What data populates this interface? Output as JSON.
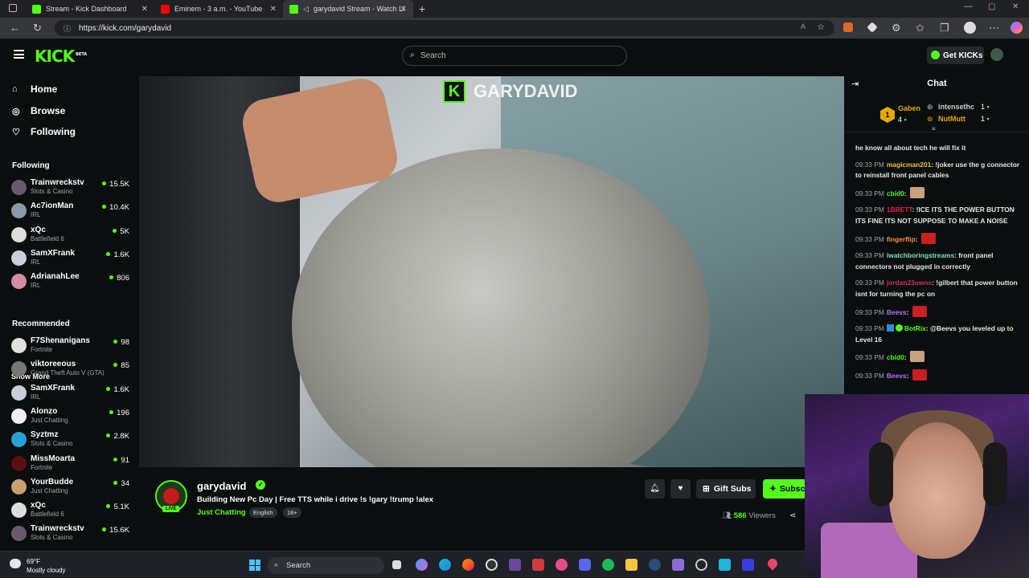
{
  "browser": {
    "tabs": [
      {
        "title": "Stream - Kick Dashboard",
        "color": "#53fc18"
      },
      {
        "title": "Eminem - 3 a.m. - YouTube",
        "color": "#ff0000"
      },
      {
        "title": "garydavid Stream - Watch Li",
        "color": "#53fc18"
      }
    ],
    "url": "https://kick.com/garydavid"
  },
  "header": {
    "logo": "KICK",
    "logo_beta": "BETA",
    "search_placeholder": "Search",
    "get_kicks": "Get KICKs"
  },
  "sidebar": {
    "nav": [
      {
        "label": "Home",
        "icon": "home-icon"
      },
      {
        "label": "Browse",
        "icon": "compass-icon"
      },
      {
        "label": "Following",
        "icon": "heart-icon"
      }
    ],
    "following_title": "Following",
    "following": [
      {
        "name": "Trainwreckstv",
        "category": "Slots & Casino",
        "viewers": "15.5K",
        "color": "#6b5a6e"
      },
      {
        "name": "Ac7ionMan",
        "category": "IRL",
        "viewers": "10.4K",
        "color": "#8899aa"
      },
      {
        "name": "xQc",
        "category": "Battlefield 6",
        "viewers": "5K",
        "color": "#dddddd"
      },
      {
        "name": "SamXFrank",
        "category": "IRL",
        "viewers": "1.6K",
        "color": "#ccccdd"
      },
      {
        "name": "AdrianahLee",
        "category": "IRL",
        "viewers": "806",
        "color": "#d68aa5"
      }
    ],
    "show_more": "Show More",
    "recommended_title": "Recommended",
    "recommended": [
      {
        "name": "F7Shenanigans",
        "category": "Fortnite",
        "viewers": "98",
        "color": "#e0e0e0"
      },
      {
        "name": "viktoreeous",
        "category": "Grand Theft Auto V (GTA)",
        "viewers": "85",
        "color": "#777777"
      },
      {
        "name": "SamXFrank",
        "category": "IRL",
        "viewers": "1.6K",
        "color": "#ccccdd"
      },
      {
        "name": "Alonzo",
        "category": "Just Chatting",
        "viewers": "196",
        "color": "#f0f0f0"
      },
      {
        "name": "Syztmz",
        "category": "Slots & Casino",
        "viewers": "2.8K",
        "color": "#2a9fd6"
      },
      {
        "name": "MissMoarta",
        "category": "Fortnite",
        "viewers": "91",
        "color": "#5a1010"
      },
      {
        "name": "YourBudde",
        "category": "Just Chatting",
        "viewers": "34",
        "color": "#c8a070"
      },
      {
        "name": "xQc",
        "category": "Battlefield 6",
        "viewers": "5.1K",
        "color": "#dddddd"
      },
      {
        "name": "Trainwreckstv",
        "category": "Slots & Casino",
        "viewers": "15.6K",
        "color": "#6b5a6e"
      }
    ]
  },
  "video": {
    "overlay_name": "GARYDAVID"
  },
  "stream": {
    "name": "garydavid",
    "live": "LIVE",
    "title": "Building New Pc Day | Free TTS while i drive !s !gary !trump !alex",
    "category": "Just Chatting",
    "tags": [
      "English",
      "18+"
    ],
    "gift_subs": "Gift Subs",
    "subscribe": "Subscribe",
    "viewers": "586",
    "viewers_label": "Viewers"
  },
  "chat": {
    "title": "Chat",
    "gifters": [
      {
        "name": "Gaben",
        "count": "4",
        "rank": "1",
        "color": "#e7a800"
      },
      {
        "name": "intensethc",
        "count": "1",
        "color": "#cccccc"
      },
      {
        "name": "NutMutt",
        "count": "1",
        "color": "#e7a800"
      }
    ],
    "messages": [
      {
        "time": "",
        "user": "",
        "color": "#e6e6e6",
        "text": "he know all about tech he will fix it"
      },
      {
        "time": "09:33 PM",
        "user": "magicman201",
        "color": "#f1c232",
        "text": "!joker use the g connector to reinstall front panel cables"
      },
      {
        "time": "09:33 PM",
        "user": "cbid0",
        "color": "#53fc18",
        "text": "",
        "emote": "#c9a080"
      },
      {
        "time": "09:33 PM",
        "user": "1BRETT",
        "color": "#e0223a",
        "text": "!ICE ITS THE POWER BUTTON ITS FINE ITS NOT SUPPOSE TO MAKE A NOISE"
      },
      {
        "time": "09:33 PM",
        "user": "fingerflip",
        "color": "#ff8c2a",
        "text": "",
        "emote": "#c92020"
      },
      {
        "time": "09:33 PM",
        "user": "iwatchboringstreams",
        "color": "#7fe0c0",
        "text": "front panel connectors not plugged in correctly"
      },
      {
        "time": "09:33 PM",
        "user": "jordan23owns",
        "color": "#d0305a",
        "text": "!gilbert that power button isnt for turning the pc on"
      },
      {
        "time": "09:33 PM",
        "user": "Beevs",
        "color": "#b070ff",
        "text": "",
        "emote": "#c92020"
      },
      {
        "time": "09:33 PM",
        "user": "BotRix",
        "color": "#53fc18",
        "text": "@Beevs you leveled up to Level 16"
      },
      {
        "time": "09:33 PM",
        "user": "cbid0",
        "color": "#53fc18",
        "text": "",
        "emote": "#c9a080"
      },
      {
        "time": "09:33 PM",
        "user": "Beevs",
        "color": "#b070ff",
        "text": "",
        "emote": "#c92020"
      }
    ]
  },
  "taskbar": {
    "temperature": "69°F",
    "condition": "Mostly cloudy",
    "search": "Search"
  }
}
